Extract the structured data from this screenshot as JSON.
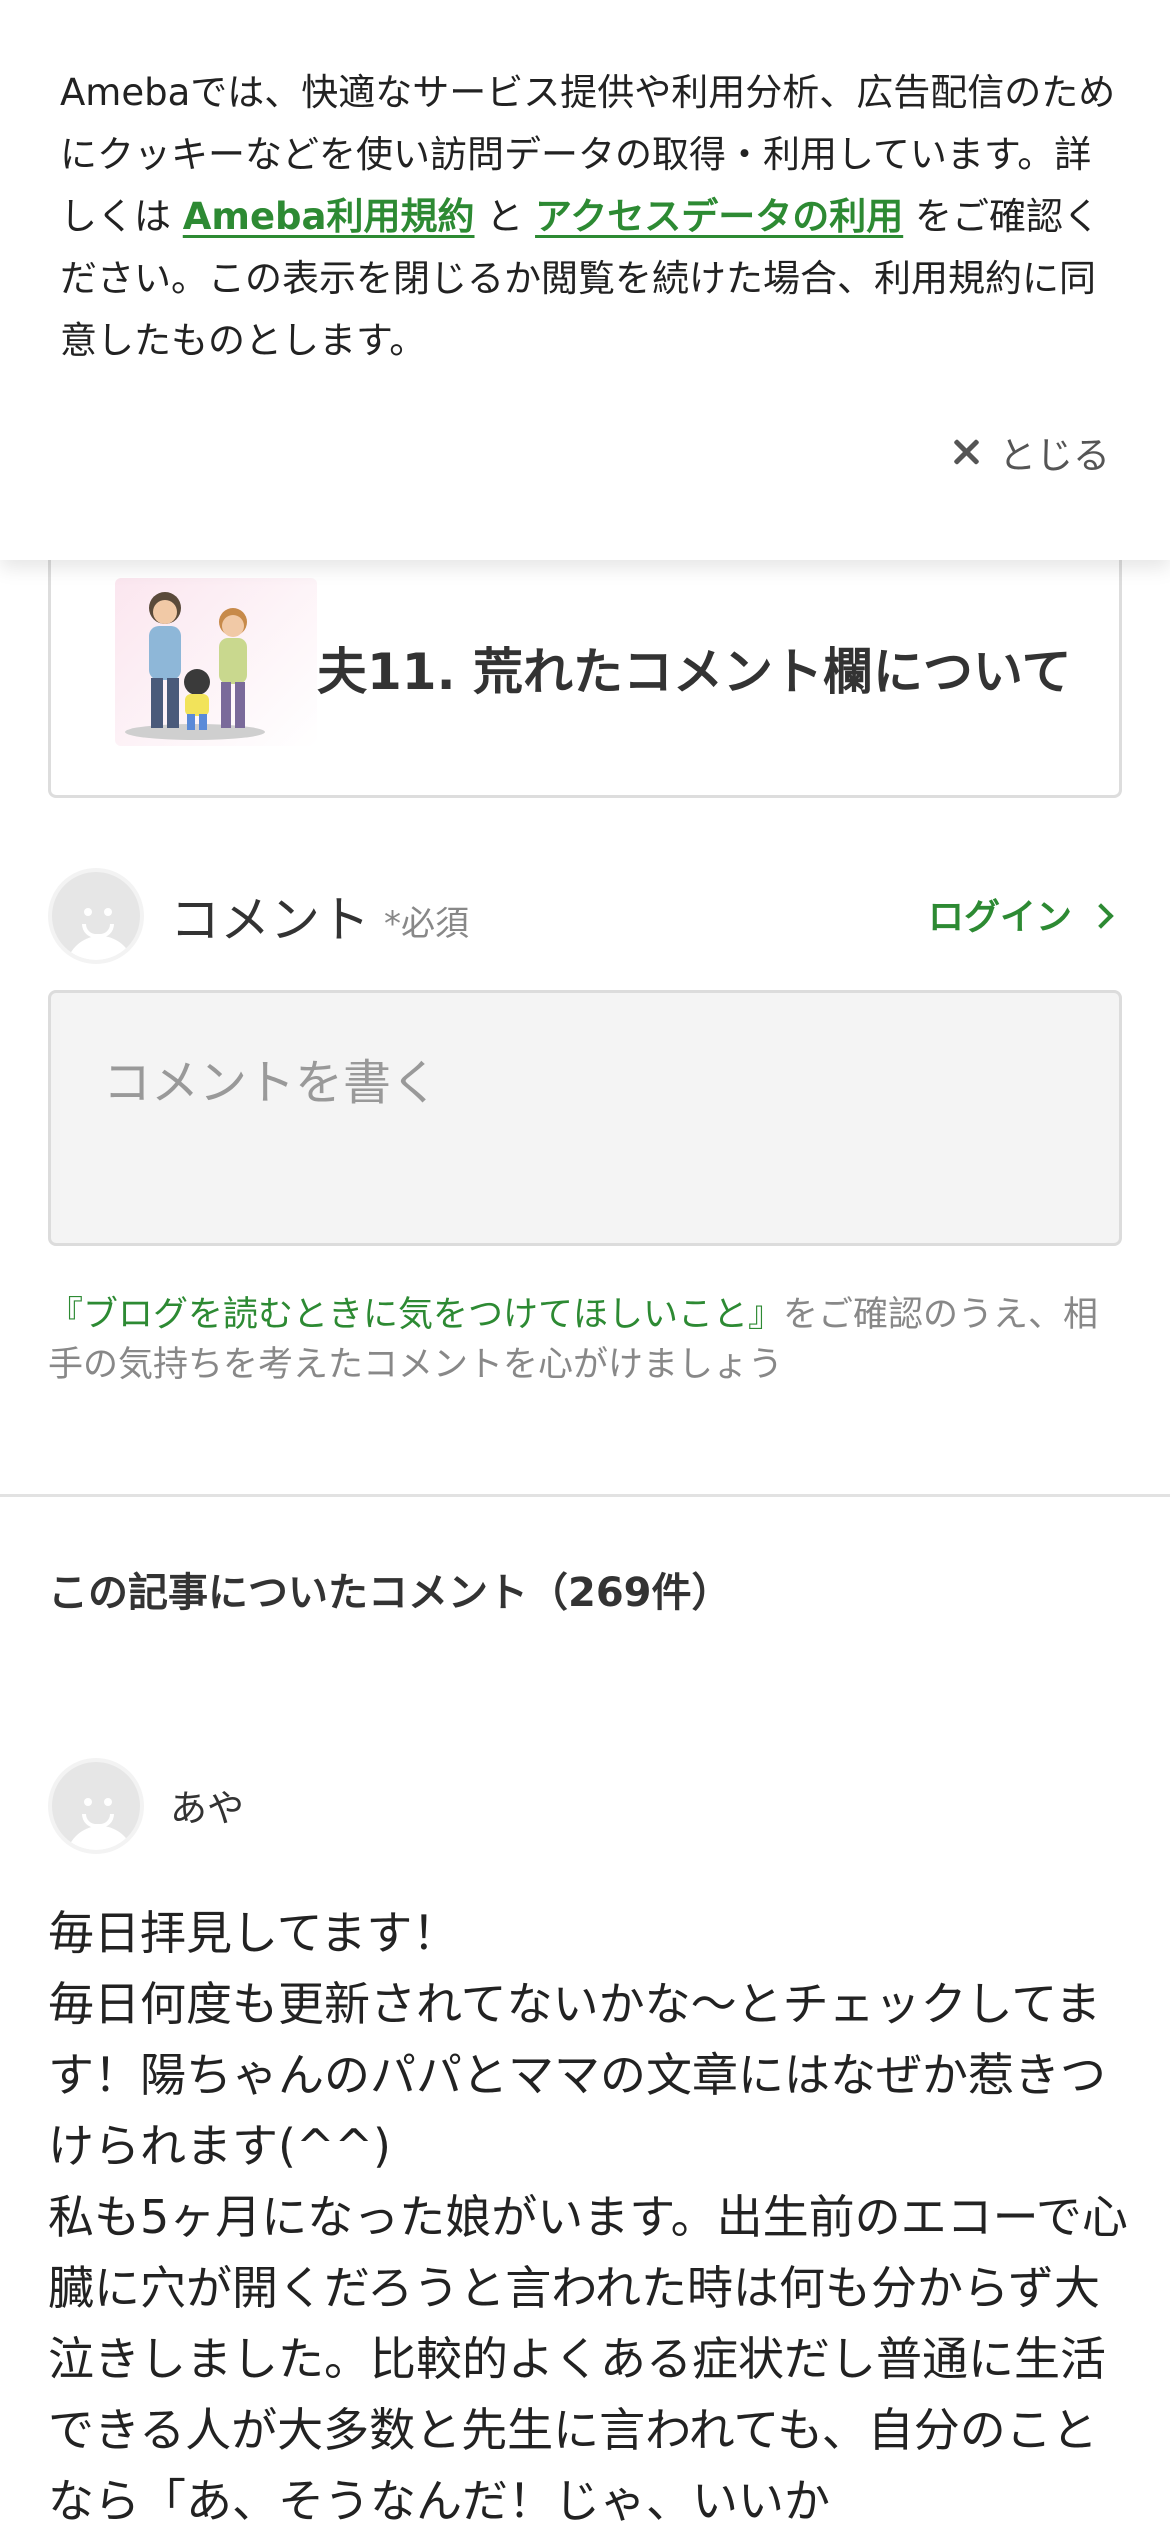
{
  "cookie_banner": {
    "text_1": "Amebaでは、快適なサービス提供や利用分析、広告配信のためにクッキーなどを使い訪問データの取得・利用しています。詳しくは ",
    "link_terms": "Ameba利用規約",
    "text_and": " と ",
    "link_access_data": "アクセスデータの利用",
    "text_2": " をご確認ください。この表示を閉じるか閲覧を続けた場合、利用規約に同意したものとします。",
    "close_label": "とじる"
  },
  "related_card": {
    "title": "夫11. 荒れたコメント欄について"
  },
  "composer": {
    "label": "コメント",
    "required": "*必須",
    "login_label": "ログイン",
    "placeholder": "コメントを書く",
    "guide_link": "『ブログを読むときに気をつけてほしいこと』",
    "guide_text": "をご確認のうえ、相手の気持ちを考えたコメントを心がけましょう"
  },
  "comments": {
    "heading": "この記事についたコメント（269件）",
    "items": [
      {
        "name": "あや",
        "body": "毎日拝見してます！\n毎日何度も更新されてないかな〜とチェックしてます！陽ちゃんのパパとママの文章にはなぜか惹きつけられます(^^)\n私も5ヶ月になった娘がいます。出生前のエコーで心臓に穴が開くだろうと言われた時は何も分からず大泣きしました。比較的よくある症状だし普通に生活できる人が大多数と先生に言われても、自分のことなら「あ、そうなんだ！じゃ、いいか"
      }
    ]
  },
  "colors": {
    "accent_green": "#2d8a33",
    "text_main": "#333333",
    "text_muted": "#888888"
  }
}
